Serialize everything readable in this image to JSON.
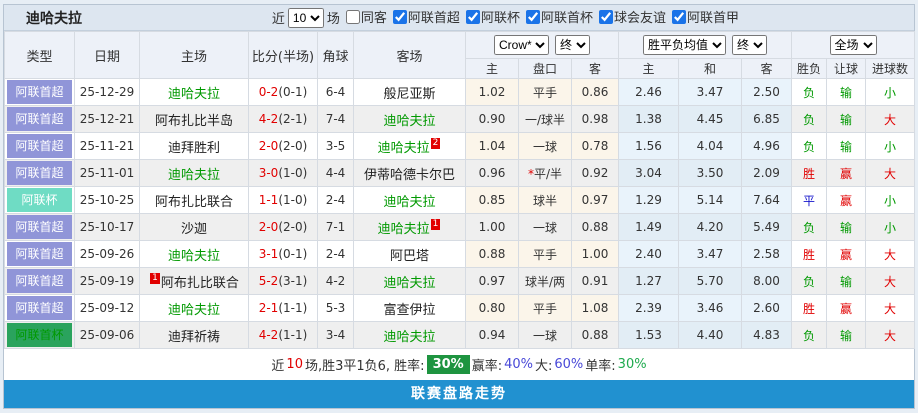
{
  "header": {
    "team": "迪哈夫拉",
    "recent_label": "近",
    "matches_count": "10",
    "matches_label": "场",
    "filters": [
      {
        "label": "同客",
        "checked": false
      },
      {
        "label": "阿联首超",
        "checked": true
      },
      {
        "label": "阿联杯",
        "checked": true
      },
      {
        "label": "阿联首杯",
        "checked": true
      },
      {
        "label": "球会友谊",
        "checked": true
      },
      {
        "label": "阿联首甲",
        "checked": true
      }
    ]
  },
  "table": {
    "columns": [
      "类型",
      "日期",
      "主场",
      "比分(半场)",
      "角球",
      "客场"
    ],
    "selects": {
      "bookmaker": "Crow*",
      "final1": "终",
      "avg": "胜平负均值",
      "final2": "终",
      "scope": "全场"
    },
    "sub_columns": [
      "主",
      "盘口",
      "客",
      "主",
      "和",
      "客",
      "胜负",
      "让球",
      "进球数"
    ],
    "rows": [
      {
        "type": "阿联首超",
        "type_color": "purple",
        "date": "25-12-29",
        "home": "迪哈夫拉",
        "home_active": true,
        "home_badge": "",
        "score": "0-2",
        "half": "(0-1)",
        "corners": "6-4",
        "away": "般尼亚斯",
        "away_active": false,
        "away_badge": "",
        "asian_home": "1.02",
        "handicap": "平手",
        "handicap_star": false,
        "asian_away": "0.86",
        "euro_home": "2.46",
        "euro_draw": "3.47",
        "euro_away": "2.50",
        "result_wdl": "负",
        "result_wdl_color": "green",
        "result_handicap": "输",
        "result_handicap_color": "green",
        "result_goals": "小",
        "result_goals_color": "green"
      },
      {
        "type": "阿联首超",
        "type_color": "purple",
        "date": "25-12-21",
        "home": "阿布扎比半岛",
        "home_active": false,
        "home_badge": "",
        "score": "4-2",
        "half": "(2-1)",
        "corners": "7-4",
        "away": "迪哈夫拉",
        "away_active": true,
        "away_badge": "",
        "asian_home": "0.90",
        "handicap": "一/球半",
        "handicap_star": false,
        "asian_away": "0.98",
        "euro_home": "1.38",
        "euro_draw": "4.45",
        "euro_away": "6.85",
        "result_wdl": "负",
        "result_wdl_color": "green",
        "result_handicap": "输",
        "result_handicap_color": "green",
        "result_goals": "大",
        "result_goals_color": "red"
      },
      {
        "type": "阿联首超",
        "type_color": "purple",
        "date": "25-11-21",
        "home": "迪拜胜利",
        "home_active": false,
        "home_badge": "",
        "score": "2-0",
        "half": "(2-0)",
        "corners": "3-5",
        "away": "迪哈夫拉",
        "away_active": true,
        "away_badge": "2",
        "asian_home": "1.04",
        "handicap": "一球",
        "handicap_star": false,
        "asian_away": "0.78",
        "euro_home": "1.56",
        "euro_draw": "4.04",
        "euro_away": "4.96",
        "result_wdl": "负",
        "result_wdl_color": "green",
        "result_handicap": "输",
        "result_handicap_color": "green",
        "result_goals": "小",
        "result_goals_color": "green"
      },
      {
        "type": "阿联首超",
        "type_color": "purple",
        "date": "25-11-01",
        "home": "迪哈夫拉",
        "home_active": true,
        "home_badge": "",
        "score": "3-0",
        "half": "(1-0)",
        "corners": "4-4",
        "away": "伊蒂哈德卡尔巴",
        "away_active": false,
        "away_badge": "",
        "asian_home": "0.96",
        "handicap": "平/半",
        "handicap_star": true,
        "asian_away": "0.92",
        "euro_home": "3.04",
        "euro_draw": "3.50",
        "euro_away": "2.09",
        "result_wdl": "胜",
        "result_wdl_color": "red",
        "result_handicap": "赢",
        "result_handicap_color": "red",
        "result_goals": "大",
        "result_goals_color": "red"
      },
      {
        "type": "阿联杯",
        "type_color": "teal",
        "date": "25-10-25",
        "home": "阿布扎比联合",
        "home_active": false,
        "home_badge": "",
        "score": "1-1",
        "half": "(1-0)",
        "corners": "2-4",
        "away": "迪哈夫拉",
        "away_active": true,
        "away_badge": "",
        "asian_home": "0.85",
        "handicap": "球半",
        "handicap_star": false,
        "asian_away": "0.97",
        "euro_home": "1.29",
        "euro_draw": "5.14",
        "euro_away": "7.64",
        "result_wdl": "平",
        "result_wdl_color": "blue",
        "result_handicap": "赢",
        "result_handicap_color": "red",
        "result_goals": "小",
        "result_goals_color": "green"
      },
      {
        "type": "阿联首超",
        "type_color": "purple",
        "date": "25-10-17",
        "home": "沙迦",
        "home_active": false,
        "home_badge": "",
        "score": "2-0",
        "half": "(2-0)",
        "corners": "7-1",
        "away": "迪哈夫拉",
        "away_active": true,
        "away_badge": "1",
        "asian_home": "1.00",
        "handicap": "一球",
        "handicap_star": false,
        "asian_away": "0.88",
        "euro_home": "1.49",
        "euro_draw": "4.20",
        "euro_away": "5.49",
        "result_wdl": "负",
        "result_wdl_color": "green",
        "result_handicap": "输",
        "result_handicap_color": "green",
        "result_goals": "小",
        "result_goals_color": "green"
      },
      {
        "type": "阿联首超",
        "type_color": "purple",
        "date": "25-09-26",
        "home": "迪哈夫拉",
        "home_active": true,
        "home_badge": "",
        "score": "3-1",
        "half": "(0-1)",
        "corners": "2-4",
        "away": "阿巴塔",
        "away_active": false,
        "away_badge": "",
        "asian_home": "0.88",
        "handicap": "平手",
        "handicap_star": false,
        "asian_away": "1.00",
        "euro_home": "2.40",
        "euro_draw": "3.47",
        "euro_away": "2.58",
        "result_wdl": "胜",
        "result_wdl_color": "red",
        "result_handicap": "赢",
        "result_handicap_color": "red",
        "result_goals": "大",
        "result_goals_color": "red"
      },
      {
        "type": "阿联首超",
        "type_color": "purple",
        "date": "25-09-19",
        "home": "阿布扎比联合",
        "home_active": false,
        "home_badge": "1",
        "score": "5-2",
        "half": "(3-1)",
        "corners": "4-2",
        "away": "迪哈夫拉",
        "away_active": true,
        "away_badge": "",
        "asian_home": "0.97",
        "handicap": "球半/两",
        "handicap_star": false,
        "asian_away": "0.91",
        "euro_home": "1.27",
        "euro_draw": "5.70",
        "euro_away": "8.00",
        "result_wdl": "负",
        "result_wdl_color": "green",
        "result_handicap": "输",
        "result_handicap_color": "green",
        "result_goals": "大",
        "result_goals_color": "red"
      },
      {
        "type": "阿联首超",
        "type_color": "purple",
        "date": "25-09-12",
        "home": "迪哈夫拉",
        "home_active": true,
        "home_badge": "",
        "score": "2-1",
        "half": "(1-1)",
        "corners": "5-3",
        "away": "富查伊拉",
        "away_active": false,
        "away_badge": "",
        "asian_home": "0.80",
        "handicap": "平手",
        "handicap_star": false,
        "asian_away": "1.08",
        "euro_home": "2.39",
        "euro_draw": "3.46",
        "euro_away": "2.60",
        "result_wdl": "胜",
        "result_wdl_color": "red",
        "result_handicap": "赢",
        "result_handicap_color": "red",
        "result_goals": "大",
        "result_goals_color": "red"
      },
      {
        "type": "阿联首杯",
        "type_color": "green",
        "date": "25-09-06",
        "home": "迪拜祈祷",
        "home_active": false,
        "home_badge": "",
        "score": "4-2",
        "half": "(1-1)",
        "corners": "3-4",
        "away": "迪哈夫拉",
        "away_active": true,
        "away_badge": "",
        "asian_home": "0.94",
        "handicap": "一球",
        "handicap_star": false,
        "asian_away": "0.88",
        "euro_home": "1.53",
        "euro_draw": "4.40",
        "euro_away": "4.83",
        "result_wdl": "负",
        "result_wdl_color": "green",
        "result_handicap": "输",
        "result_handicap_color": "green",
        "result_goals": "大",
        "result_goals_color": "red"
      }
    ]
  },
  "summary": {
    "segments": [
      {
        "text": "近",
        "color": "dark"
      },
      {
        "text": "10",
        "color": "red"
      },
      {
        "text": "场,胜3平1负6, 胜率:",
        "color": "dark"
      },
      {
        "text": "30%",
        "color": "badge-green"
      },
      {
        "text": "赢率:",
        "color": "dark"
      },
      {
        "text": "40%",
        "color": "blue"
      },
      {
        "text": " 大:",
        "color": "dark"
      },
      {
        "text": "60%",
        "color": "blue"
      },
      {
        "text": " 单率:",
        "color": "dark"
      },
      {
        "text": "30%",
        "color": "green"
      }
    ]
  },
  "footer": {
    "label": "联赛盘路走势"
  }
}
